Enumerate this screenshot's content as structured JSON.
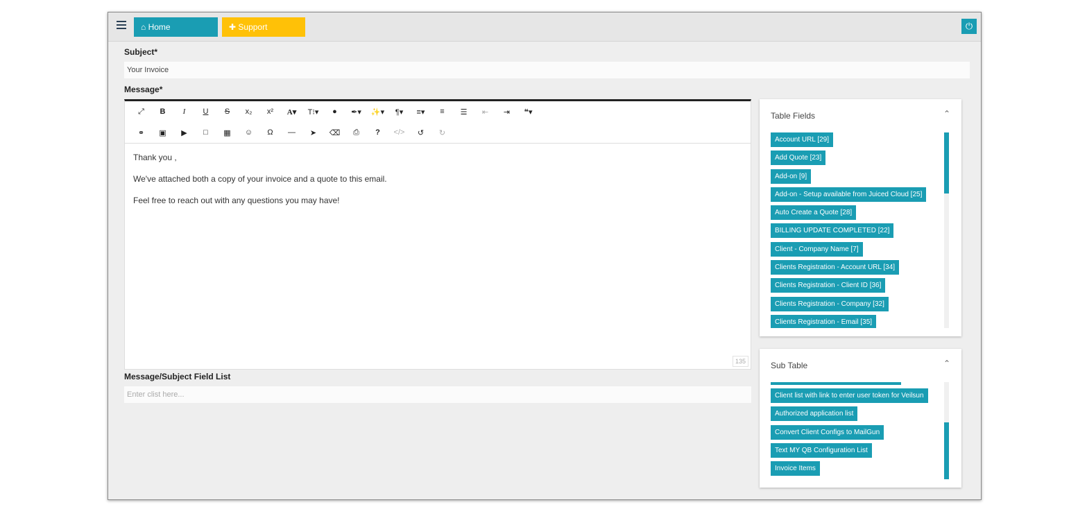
{
  "nav": {
    "home_label": "Home",
    "support_label": "Support"
  },
  "form": {
    "subject_label": "Subject*",
    "subject_value": "Your Invoice",
    "message_label": "Message*",
    "message_lines": [
      "Thank you ,",
      "We've attached both a copy of your invoice and a quote to this email.",
      "Feel free to reach out with any questions you may have!"
    ],
    "char_count": "135",
    "field_list_label": "Message/Subject Field List",
    "field_list_placeholder": "Enter clist here..."
  },
  "table_fields": {
    "title": "Table Fields",
    "items": [
      "Account URL [29]",
      "Add Quote [23]",
      "Add-on [9]",
      "Add-on - Setup available from Juiced Cloud [25]",
      "Auto Create a Quote [28]",
      "BILLING UPDATE COMPLETED [22]",
      "Client - Company Name [7]",
      "Clients Registration - Account URL [34]",
      "Clients Registration - Client ID [36]",
      "Clients Registration - Company [32]",
      "Clients Registration - Email [35]"
    ]
  },
  "sub_table": {
    "title": "Sub Table",
    "items": [
      "Client list with link to enter user token for Veilsun",
      "Authorized application list",
      "Convert Client Configs to MailGun",
      "Text MY QB Configuration List",
      "Invoice Items"
    ]
  },
  "colors": {
    "accent": "#1a9db3",
    "support": "#ffc107"
  }
}
